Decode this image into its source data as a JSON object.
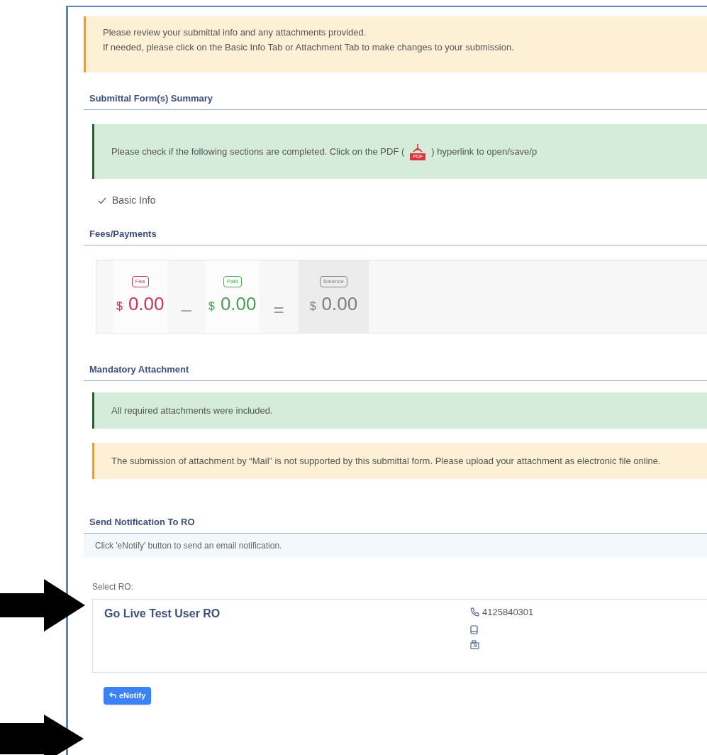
{
  "review_alert": {
    "lines": [
      "Please review your submittal info and any attachments provided.",
      "If needed, please click on the Basic Info Tab or Attachment Tab to make changes to your submission."
    ]
  },
  "summary": {
    "heading": "Submittal Form(s) Summary",
    "notice_before": "Please check if the following sections are completed. Click on the PDF (",
    "pdf_label": "PDF",
    "notice_after": ") hyperlink to open/save/p",
    "sections": [
      {
        "label": "Basic Info",
        "checked": true
      }
    ]
  },
  "fees": {
    "heading": "Fees/Payments",
    "items": [
      {
        "kind": "fee",
        "tag": "Fee",
        "currency": "$",
        "amount": "0.00"
      },
      {
        "kind": "operator",
        "symbol": "–"
      },
      {
        "kind": "paid",
        "tag": "Paid",
        "currency": "$",
        "amount": "0.00"
      },
      {
        "kind": "operator",
        "symbol": "="
      },
      {
        "kind": "balance",
        "tag": "Balance",
        "currency": "$",
        "amount": "0.00"
      }
    ]
  },
  "attachments": {
    "heading": "Mandatory Attachment",
    "alerts": [
      {
        "kind": "success",
        "text": "All required attachments were included."
      },
      {
        "kind": "warning",
        "text": "The submission of attachment by “Mail” is not supported by this submittal form. Please upload your attachment as electronic file online."
      }
    ]
  },
  "notification": {
    "heading": "Send Notification To RO",
    "info": "Click 'eNotify' button to send an email notification.",
    "select_label": "Select RO:",
    "ro": {
      "name": "Go Live Test User RO",
      "phone": "4125840301"
    },
    "button": "eNotify"
  }
}
